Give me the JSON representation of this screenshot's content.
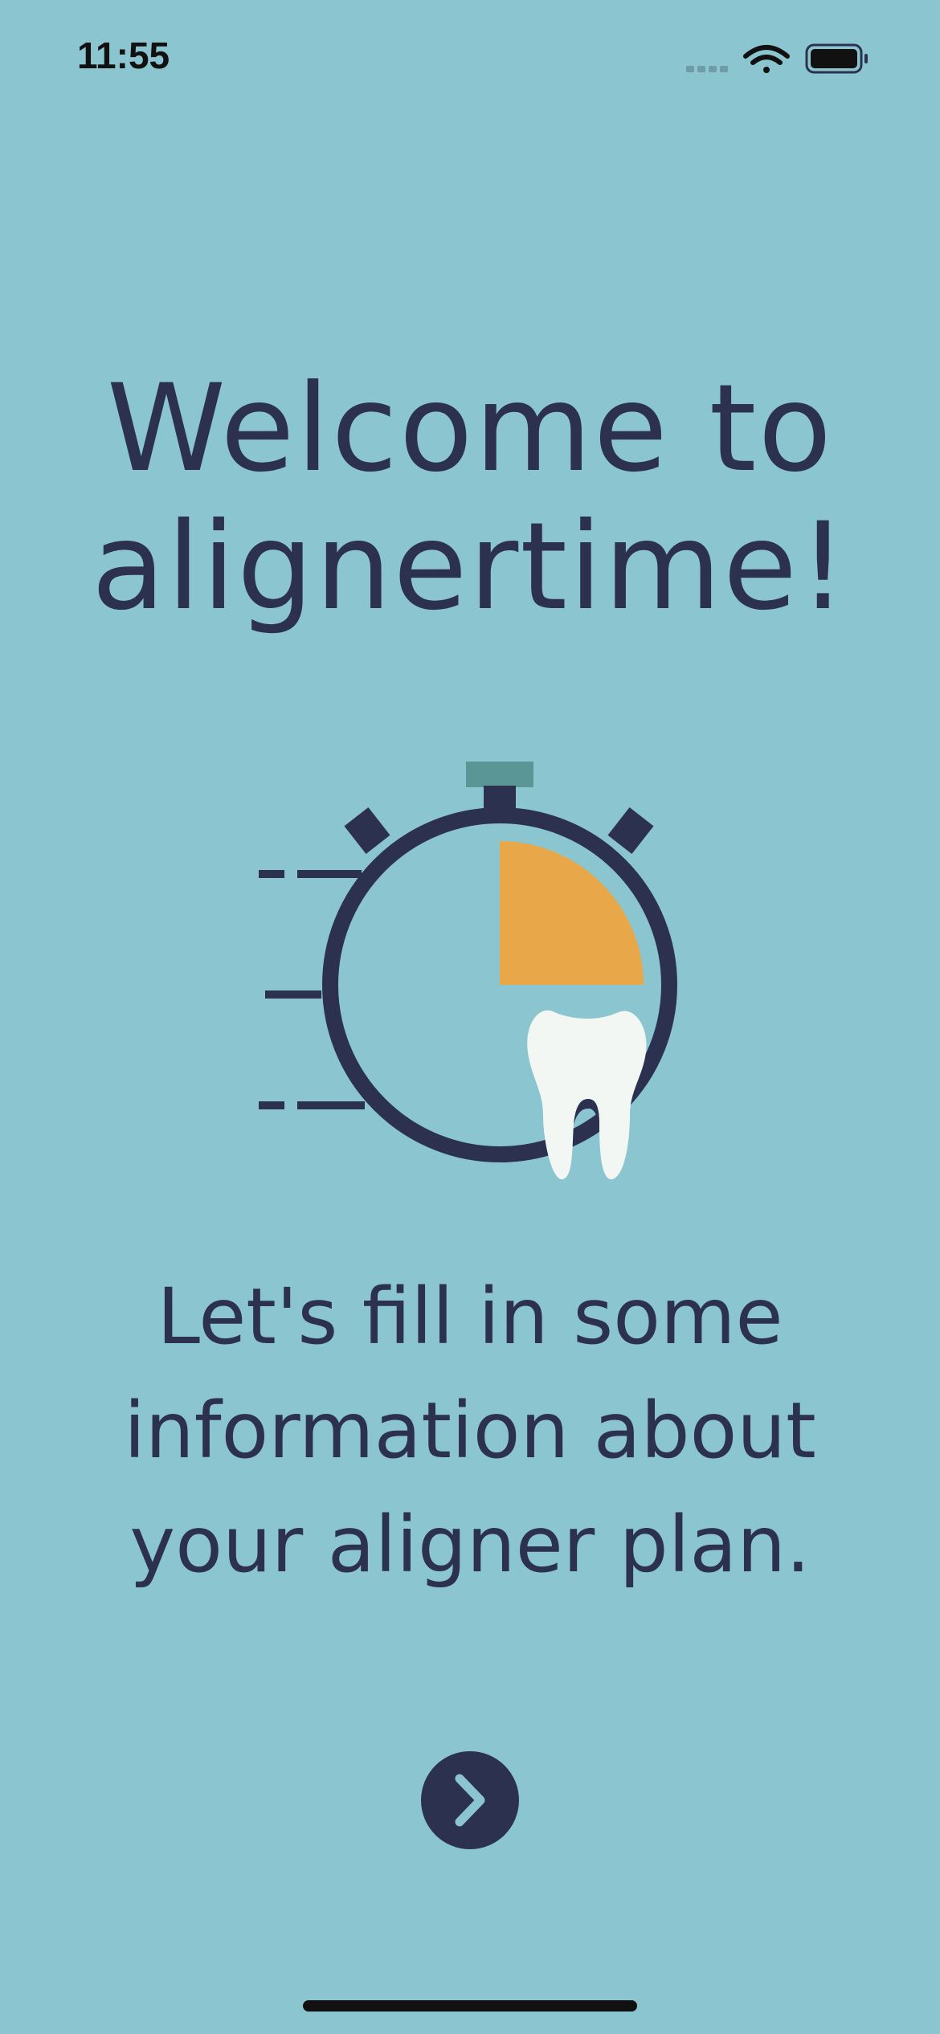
{
  "status_bar": {
    "time": "11:55",
    "icons": [
      "signal-icon",
      "wifi-icon",
      "battery-icon"
    ]
  },
  "welcome": {
    "line1": "Welcome to",
    "line2": "alignertime!"
  },
  "illustration": {
    "icon": "stopwatch-tooth-icon"
  },
  "intro": {
    "line1": "Let's fill in some",
    "line2": "information about",
    "line3": "your aligner plan."
  },
  "next_button": {
    "icon": "chevron-right-icon"
  },
  "colors": {
    "background": "#8BC6D0",
    "text": "#2C3150",
    "accent": "#E8A748",
    "tooth": "#F2F7F4",
    "stopwatch_crown": "#5B9696"
  }
}
